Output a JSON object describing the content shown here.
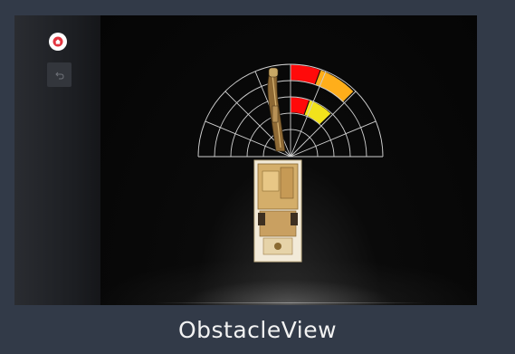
{
  "caption": "ObstacleView",
  "sidebar": {
    "home_icon": "home-icon",
    "back_icon": "back-arrow-icon"
  },
  "radar": {
    "sectors": [
      {
        "side": "right",
        "ring": "outer",
        "position": "inner",
        "status": "red"
      },
      {
        "side": "right",
        "ring": "outer",
        "position": "middle",
        "status": "orange"
      },
      {
        "side": "right",
        "ring": "inner",
        "position": "inner",
        "status": "red"
      },
      {
        "side": "right",
        "ring": "inner",
        "position": "middle",
        "status": "yellow"
      }
    ]
  },
  "colors": {
    "frame": "#323a48",
    "screen": "#0b0c0e",
    "danger": "#ff0a0a",
    "warning": "#ffae1a",
    "caution": "#f2e21c",
    "home_accent": "#e2353f"
  }
}
